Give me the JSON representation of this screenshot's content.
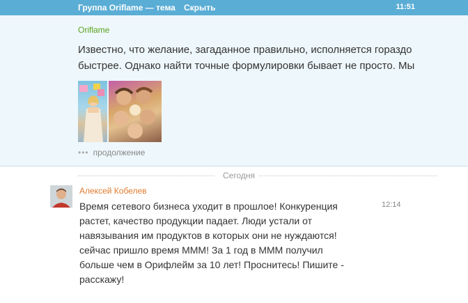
{
  "topbar": {
    "title": "Группа Oriflame — тема",
    "hide": "Скрыть",
    "time": "11:51"
  },
  "pinned": {
    "author": "Oriflame",
    "text": "Известно, что желание, загаданное правильно, исполняется гораздо быстрее. Однако найти точные формулировки бывает не просто. Мы",
    "more": "продолжение"
  },
  "separator": "Сегодня",
  "message": {
    "author": "Алексей Кобелев",
    "time": "12:14",
    "text": "Время сетевого бизнеса уходит в прошлое! Конкуренция растет, качество продукции падает. Люди устали от навязывания им продуктов в которых они не нуждаются! сейчас пришло время МММ! За 1 год в МММ получил больше чем в Орифлейм за 10 лет! Проснитесь! Пишите - расскажу!"
  },
  "colors": {
    "topbar": "#5aadd5",
    "pinned_bg": "#eef7fb",
    "group_author": "#5aa31c",
    "user_author": "#e07b2e"
  },
  "icons": {
    "more": "ellipsis-icon"
  }
}
